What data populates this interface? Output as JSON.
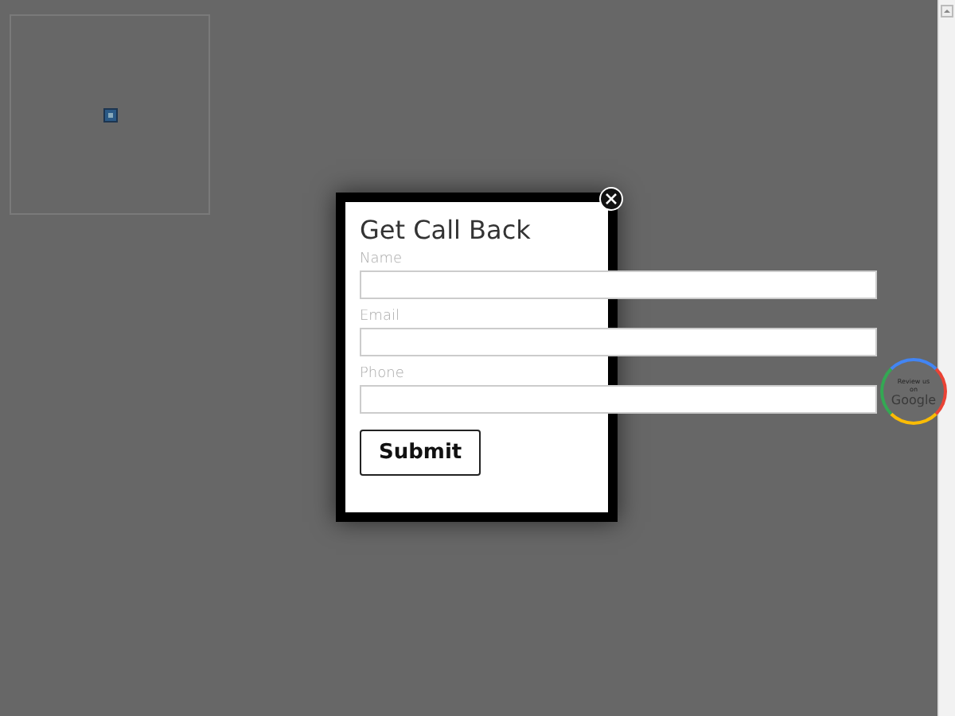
{
  "modal": {
    "title": "Get Call Back",
    "fields": [
      {
        "label": "Name"
      },
      {
        "label": "Email"
      },
      {
        "label": "Phone"
      }
    ],
    "submit": "Submit"
  },
  "badge": {
    "line1": "Review us",
    "line2": "on",
    "brand": "Google"
  }
}
